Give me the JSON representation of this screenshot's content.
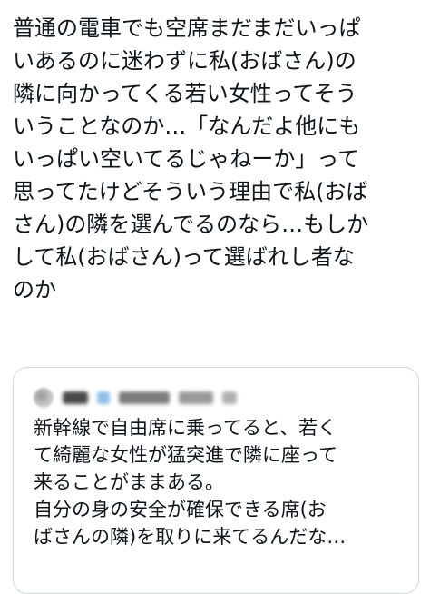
{
  "post": {
    "lines": [
      "普通の電車でも空席まだまだいっぱ",
      "いあるのに迷わずに私(おばさん)の",
      "隣に向かってくる若い女性ってそう",
      "いうことなのか…「なんだよ他にも",
      "いっぱい空いてるじゃねーか」って",
      "思ってたけどそういう理由で私(おば",
      "さん)の隣を選んでるのなら…もしか",
      "して私(おばさん)って選ばれし者な",
      "のか"
    ]
  },
  "quote": {
    "lines": [
      "新幹線で自由席に乗ってると、若く",
      "て綺麗な女性が猛突進で隣に座って",
      "来ることがままある。",
      "自分の身の安全が確保できる席(お",
      "ばさんの隣)を取りに来てるんだな…"
    ]
  }
}
